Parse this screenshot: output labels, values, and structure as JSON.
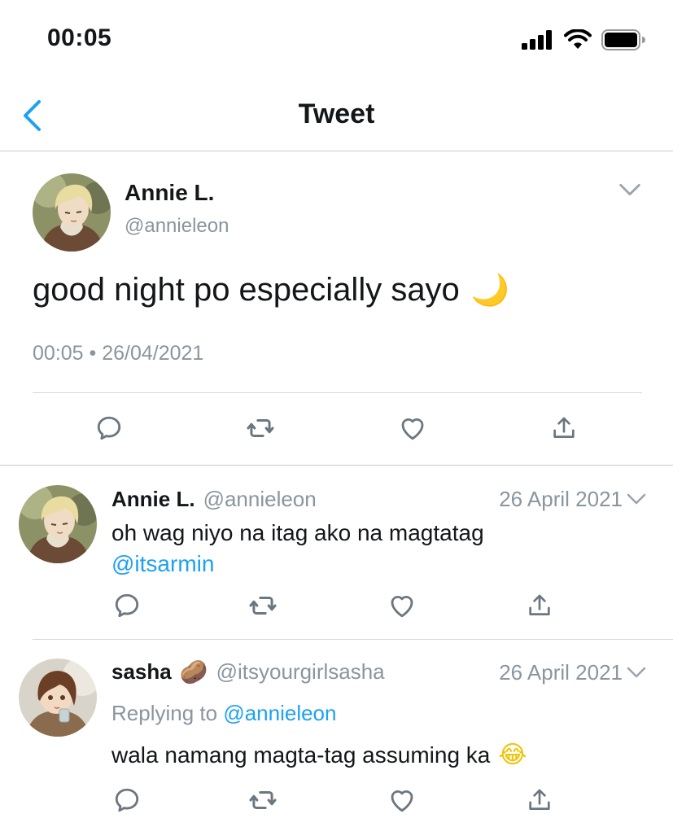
{
  "status_bar": {
    "time": "00:05"
  },
  "nav": {
    "title": "Tweet"
  },
  "main_tweet": {
    "name": "Annie L.",
    "handle": "@annieleon",
    "text": "good night po especially sayo",
    "emoji": "🌙",
    "timestamp": "00:05 • 26/04/2021"
  },
  "replies": [
    {
      "name": "Annie L.",
      "handle": "@annieleon",
      "date": "26 April 2021",
      "text": "oh wag niyo na itag ako na magtatag",
      "mention": "@itsarmin"
    },
    {
      "name": "sasha",
      "name_emoji": "🥔",
      "handle": "@itsyourgirlsasha",
      "date": "26 April 2021",
      "replying_label": "Replying to",
      "replying_to": "@annieleon",
      "text": "wala namang magta-tag assuming ka",
      "text_emoji": "😂"
    }
  ],
  "icons": {
    "back": "chevron-left-icon",
    "caret": "chevron-down-icon",
    "reply": "comment-icon",
    "retweet": "retweet-icon",
    "like": "heart-icon",
    "share": "share-icon"
  },
  "colors": {
    "accent": "#1da1f2",
    "muted": "#8a959f",
    "text": "#14171a",
    "divider": "#c6ccd1"
  }
}
